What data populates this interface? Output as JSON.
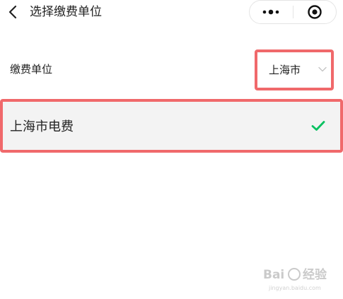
{
  "header": {
    "title": "选择缴费单位",
    "back_icon": "chevron-left-icon",
    "more_icon": "more-dots-icon",
    "close_icon": "target-circle-icon"
  },
  "payment_unit": {
    "label": "缴费单位",
    "selected_value": "上海市",
    "dropdown_icon": "chevron-down-icon"
  },
  "options": [
    {
      "label": "上海市电费",
      "selected": true,
      "check_icon": "checkmark-icon"
    }
  ],
  "watermark": {
    "text": "Bai 经验",
    "subtext": "jingyan.baidu.com"
  },
  "colors": {
    "highlight_border": "#f0696b",
    "checkmark": "#07c160",
    "option_background": "#f3f3f3",
    "text": "#222222"
  }
}
